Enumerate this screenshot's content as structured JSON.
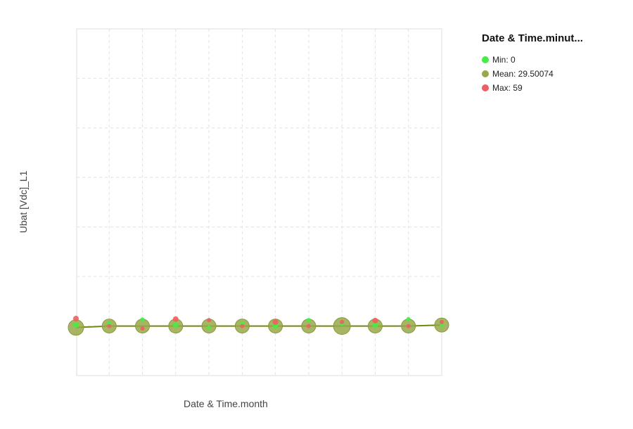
{
  "chart_data": {
    "type": "scatter",
    "xlabel": "Date & Time.month",
    "ylabel": "Ubat [Vdc]_L1",
    "legend": {
      "title": "Date & Time.minut...",
      "placement": "top-right",
      "entries": [
        {
          "label": "Min: 0",
          "color": "#44ee44"
        },
        {
          "label": "Mean: 29.50074",
          "color": "#98a84a"
        },
        {
          "label": "Max: 59",
          "color": "#ee6060"
        }
      ]
    },
    "grid": true,
    "x": [
      1,
      2,
      3,
      4,
      5,
      6,
      7,
      8,
      9,
      10,
      11,
      12
    ],
    "xlim": [
      1,
      12
    ],
    "ylim": [
      -1,
      6
    ],
    "series": [
      {
        "name": "Min: 0",
        "color": "#44ee44",
        "values": [
          0.02,
          0.06,
          0.13,
          0.02,
          -0.03,
          0.05,
          0.01,
          0.12,
          0.04,
          0.02,
          0.14,
          0.02
        ]
      },
      {
        "name": "Mean: 29.50074",
        "color": "#98a84a",
        "values": [
          -0.03,
          0.0,
          0.0,
          0.0,
          0.0,
          0.0,
          0.0,
          0.0,
          0.0,
          0.0,
          0.0,
          0.02
        ]
      },
      {
        "name": "Max: 59",
        "color": "#ee6060",
        "values": [
          0.15,
          0.0,
          -0.05,
          0.14,
          0.12,
          0.0,
          0.08,
          0.0,
          0.08,
          0.11,
          0.0,
          0.08
        ]
      }
    ]
  }
}
